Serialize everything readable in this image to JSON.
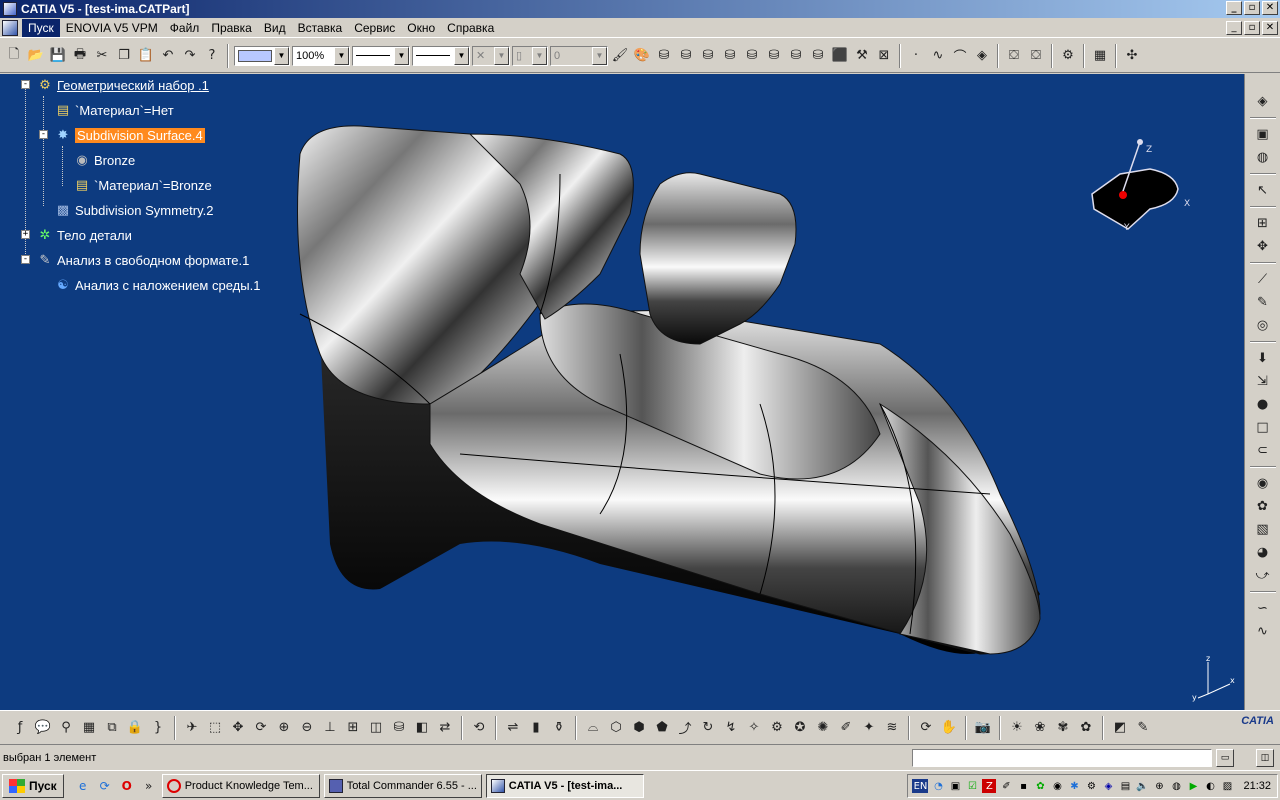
{
  "window": {
    "title": "CATIA V5 - [test-ima.CATPart]",
    "min": "_",
    "max": "▫",
    "close": "✕"
  },
  "menu": {
    "items": [
      "Пуск",
      "ENOVIA V5 VPM",
      "Файл",
      "Правка",
      "Вид",
      "Вставка",
      "Сервис",
      "Окно",
      "Справка"
    ]
  },
  "toolbar": {
    "color_swatch": "#b8c8ff",
    "zoom_value": "100%",
    "layer_value": "0",
    "icons": [
      "new-icon",
      "open-icon",
      "save-icon",
      "print-icon",
      "cut-icon",
      "copy-icon",
      "paste-icon",
      "undo-icon",
      "redo-icon",
      "whats-this-icon"
    ]
  },
  "tree": {
    "nodes": [
      {
        "label": "Геометрический набор .1",
        "icon": "geometric-set-icon"
      },
      {
        "label": "`Материал`=Нет",
        "icon": "material-param-icon"
      },
      {
        "label": "Subdivision Surface.4",
        "icon": "subdivision-surface-icon"
      },
      {
        "label": "Bronze",
        "icon": "material-sphere-icon"
      },
      {
        "label": "`Материал`=Bronze",
        "icon": "material-param-icon"
      },
      {
        "label": "Subdivision Symmetry.2",
        "icon": "symmetry-icon"
      },
      {
        "label": "Тело детали",
        "icon": "part-body-icon"
      },
      {
        "label": "Анализ в свободном формате.1",
        "icon": "freeform-analysis-icon"
      },
      {
        "label": "Анализ с наложением среды.1",
        "icon": "environment-mapping-icon"
      }
    ]
  },
  "compass": {
    "z_label": "Z",
    "x_label": "X",
    "y_label": "Y"
  },
  "axis_triad": {
    "z_label": "z",
    "x_label": "x",
    "y_label": "y"
  },
  "status": {
    "text": "выбран 1 элемент"
  },
  "taskbar": {
    "start_label": "Пуск",
    "more": "»",
    "tasks": [
      {
        "label": "Product Knowledge Tem...",
        "active": false
      },
      {
        "label": "Total Commander 6.55 - ...",
        "active": false
      },
      {
        "label": "CATIA V5 - [test-ima...",
        "active": true
      }
    ],
    "language": "EN",
    "clock": "21:32"
  },
  "brand": {
    "logo_text": "CATIA"
  },
  "colors": {
    "viewport_bg": "#0d3b80",
    "selection": "#ff8a1e",
    "title_bar": "#0a246a"
  }
}
